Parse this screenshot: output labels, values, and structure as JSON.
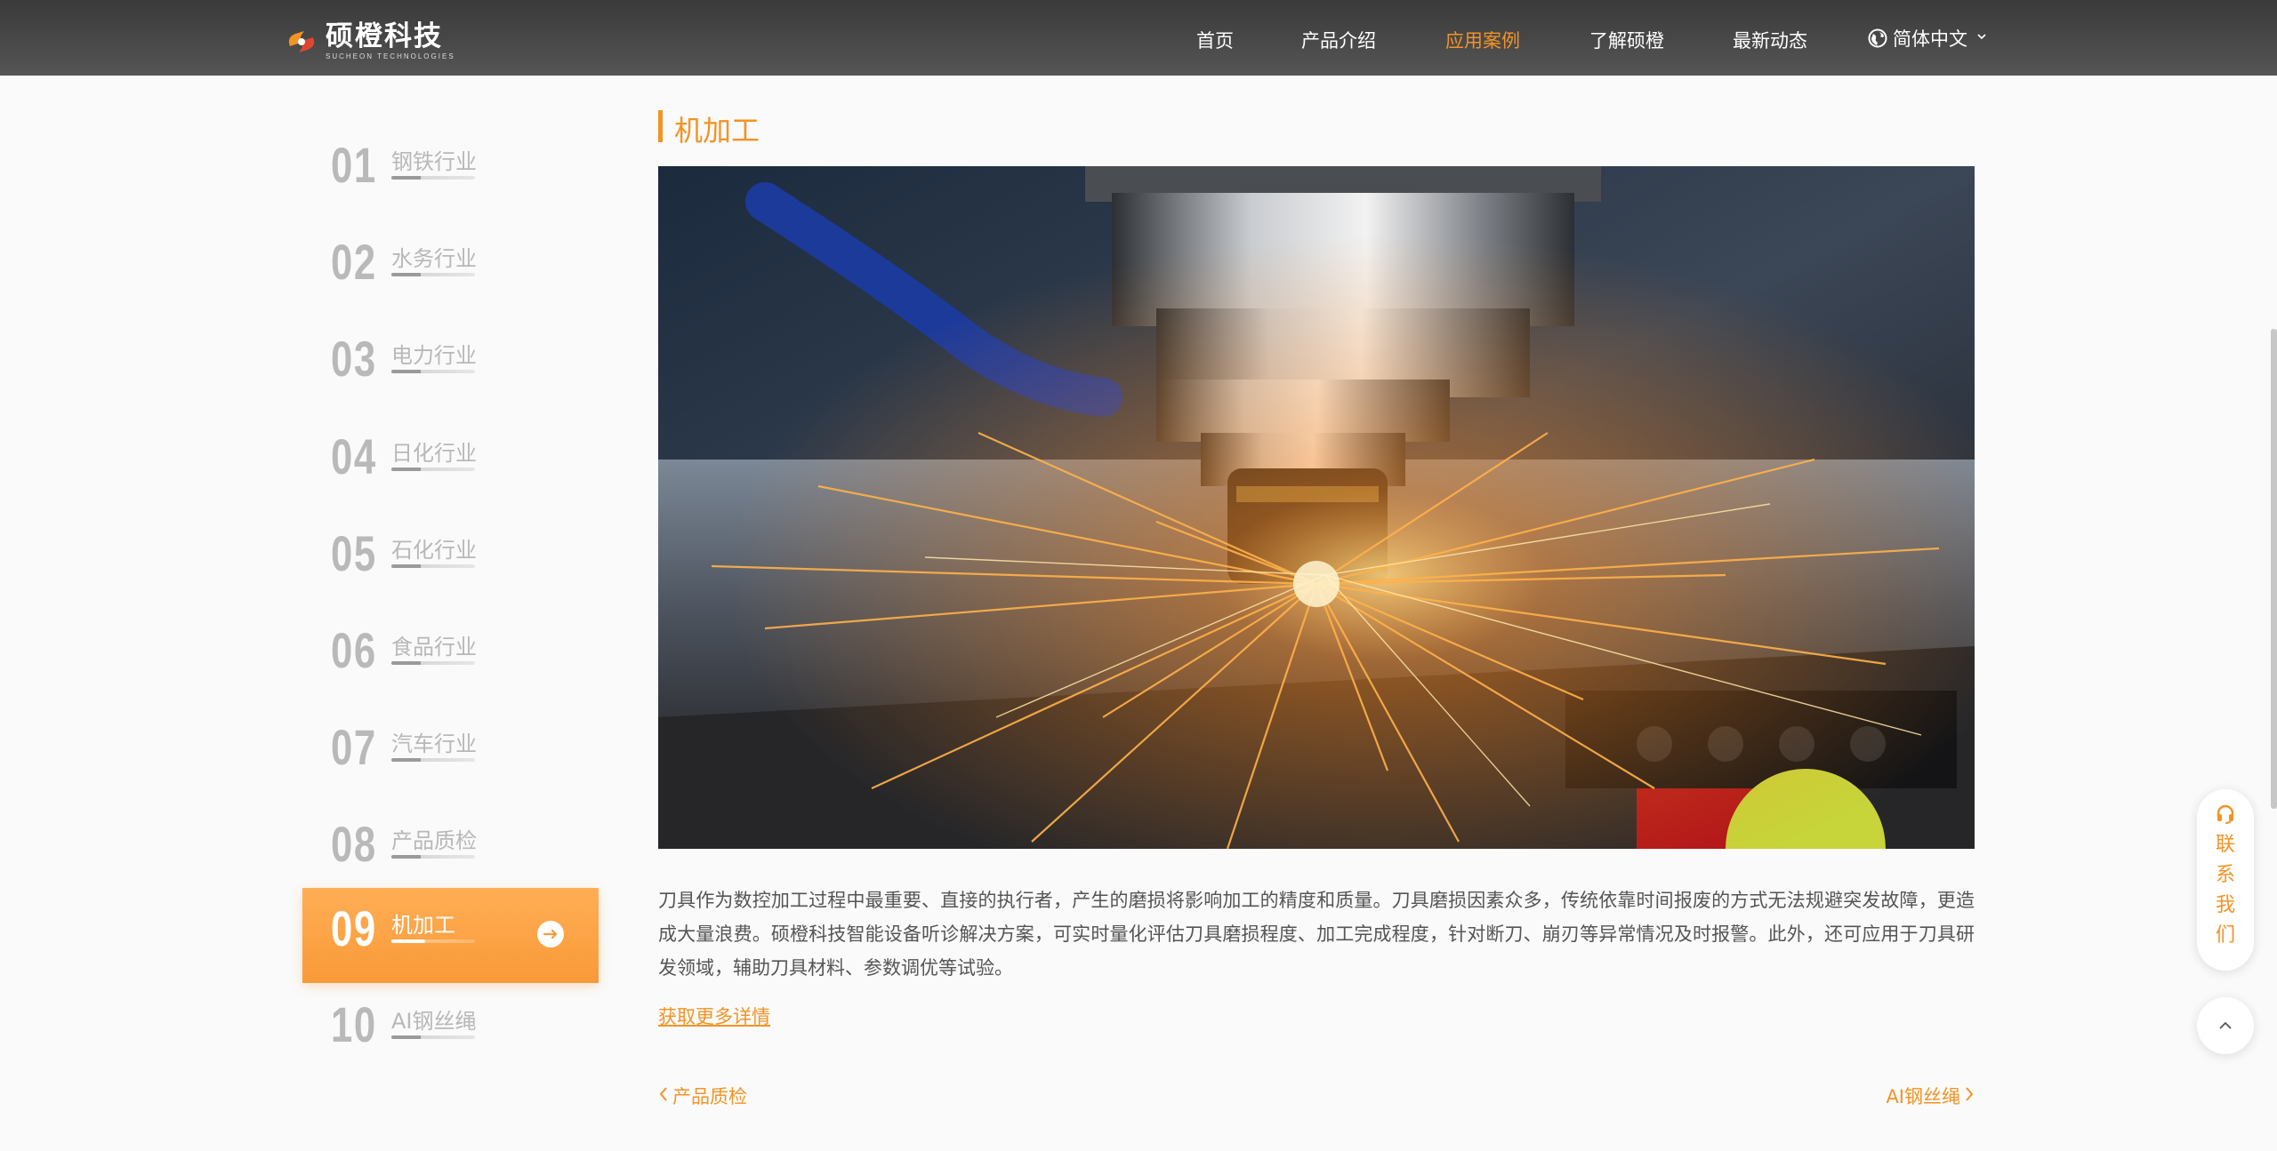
{
  "header": {
    "logo_cn": "硕橙科技",
    "logo_en": "SUCHEON TECHNOLOGIES",
    "nav": [
      {
        "label": "首页",
        "active": false
      },
      {
        "label": "产品介绍",
        "active": false
      },
      {
        "label": "应用案例",
        "active": true
      },
      {
        "label": "了解硕橙",
        "active": false
      },
      {
        "label": "最新动态",
        "active": false
      }
    ],
    "language": "简体中文",
    "language_icon": "globe-icon"
  },
  "sidebar": {
    "items": [
      {
        "num": "01",
        "label": "钢铁行业",
        "active": false
      },
      {
        "num": "02",
        "label": "水务行业",
        "active": false
      },
      {
        "num": "03",
        "label": "电力行业",
        "active": false
      },
      {
        "num": "04",
        "label": "日化行业",
        "active": false
      },
      {
        "num": "05",
        "label": "石化行业",
        "active": false
      },
      {
        "num": "06",
        "label": "食品行业",
        "active": false
      },
      {
        "num": "07",
        "label": "汽车行业",
        "active": false
      },
      {
        "num": "08",
        "label": "产品质检",
        "active": false
      },
      {
        "num": "09",
        "label": "机加工",
        "active": true
      },
      {
        "num": "10",
        "label": "AI钢丝绳",
        "active": false
      }
    ]
  },
  "main": {
    "title": "机加工",
    "description": "刀具作为数控加工过程中最重要、直接的执行者，产生的磨损将影响加工的精度和质量。刀具磨损因素众多，传统依靠时间报废的方式无法规避突发故障，更造成大量浪费。硕橙科技智能设备听诊解决方案，可实时量化评估刀具磨损程度、加工完成程度，针对断刀、崩刃等异常情况及时报警。此外，还可应用于刀具研发领域，辅助刀具材料、参数调优等试验。",
    "more_link": "获取更多详情",
    "prev_label": "产品质检",
    "next_label": "AI钢丝绳"
  },
  "floating": {
    "contact_label": "联系我们"
  },
  "colors": {
    "accent": "#f39324",
    "header_bg": "#444444",
    "page_bg": "#fafafa"
  }
}
